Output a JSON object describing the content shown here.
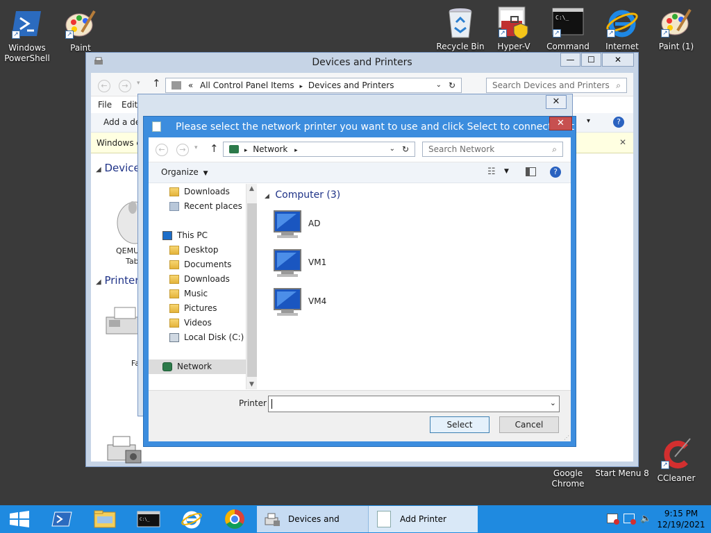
{
  "desktop": {
    "icons_left": [
      {
        "label": "Windows PowerShell",
        "icon": "powershell-icon"
      },
      {
        "label": "Paint",
        "icon": "paint-icon"
      }
    ],
    "icons_right": [
      {
        "label": "Recycle Bin",
        "icon": "recycle-bin-icon"
      },
      {
        "label": "Hyper-V",
        "icon": "hyper-v-icon"
      },
      {
        "label": "Command",
        "icon": "command-prompt-icon"
      },
      {
        "label": "Internet",
        "icon": "internet-explorer-icon"
      },
      {
        "label": "Paint (1)",
        "icon": "paint-icon"
      }
    ],
    "icons_bottom": [
      {
        "label": "Google Chrome",
        "icon": "chrome-icon"
      },
      {
        "label": "Start Menu 8",
        "icon": "start-menu-icon"
      },
      {
        "label": "CCleaner",
        "icon": "ccleaner-icon"
      }
    ]
  },
  "devices_window": {
    "title": "Devices and Printers",
    "breadcrumb_prefix": "«",
    "breadcrumb": [
      "All Control Panel Items",
      "Devices and Printers"
    ],
    "search_placeholder": "Search Devices and Printers",
    "menu": [
      "File",
      "Edit"
    ],
    "cmd_add": "Add a dev",
    "info_text": "Windows ca",
    "group_devices": "Devices",
    "device_label_1": "QEMU",
    "device_label_2": "Tab",
    "group_printers": "Printers",
    "printer_label": "Fa"
  },
  "select_dialog": {
    "title": "Please select the network printer you want to use and click Select to connect to it",
    "address": "Network",
    "search_placeholder": "Search Network",
    "organize_label": "Organize",
    "nav_items": [
      {
        "label": "Downloads",
        "icon": "downloads-folder-icon",
        "indent": 1
      },
      {
        "label": "Recent places",
        "icon": "recent-places-icon",
        "indent": 1
      },
      {
        "label": "This PC",
        "icon": "this-pc-icon",
        "indent": 0
      },
      {
        "label": "Desktop",
        "icon": "desktop-folder-icon",
        "indent": 1
      },
      {
        "label": "Documents",
        "icon": "documents-folder-icon",
        "indent": 1
      },
      {
        "label": "Downloads",
        "icon": "downloads-folder-icon",
        "indent": 1
      },
      {
        "label": "Music",
        "icon": "music-folder-icon",
        "indent": 1
      },
      {
        "label": "Pictures",
        "icon": "pictures-folder-icon",
        "indent": 1
      },
      {
        "label": "Videos",
        "icon": "videos-folder-icon",
        "indent": 1
      },
      {
        "label": "Local Disk (C:)",
        "icon": "local-disk-icon",
        "indent": 1
      },
      {
        "label": "Network",
        "icon": "network-icon",
        "indent": 0,
        "selected": true
      }
    ],
    "group_header": "Computer (3)",
    "computers": [
      "AD",
      "VM1",
      "VM4"
    ],
    "printer_label": "Printer",
    "printer_value": "",
    "select_label": "Select",
    "cancel_label": "Cancel"
  },
  "taskbar": {
    "tasks": [
      {
        "label": "Devices and Print...",
        "icon": "devices-printers-icon"
      },
      {
        "label": "Add Printer",
        "icon": "add-printer-icon"
      }
    ],
    "time": "9:15 PM",
    "date": "12/19/2021"
  },
  "colors": {
    "desktop": "#3a3a3a",
    "taskbar": "#1f8ae0",
    "dialog_frame": "#3c8dde",
    "close_red": "#c75050"
  }
}
